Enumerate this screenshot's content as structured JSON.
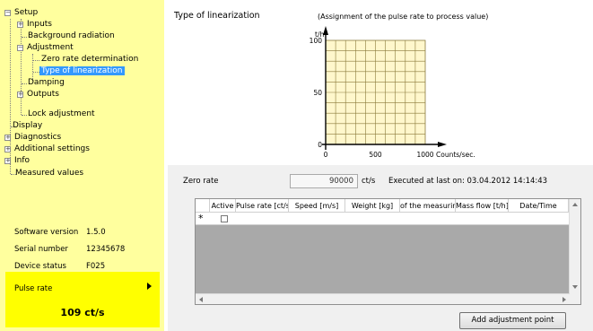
{
  "tree": {
    "items": [
      {
        "label": "Setup",
        "expander": "−"
      },
      {
        "label": "Inputs",
        "expander": "+"
      },
      {
        "label": "Background radiation"
      },
      {
        "label": "Adjustment",
        "expander": "−"
      },
      {
        "label": "Zero rate determination"
      },
      {
        "label": "Type of linearization",
        "selected": true
      },
      {
        "label": "Damping"
      },
      {
        "label": "Outputs",
        "expander": "+"
      },
      {
        "label": "Lock adjustment"
      },
      {
        "label": "Display"
      },
      {
        "label": "Diagnostics",
        "expander": "+"
      },
      {
        "label": "Additional settings",
        "expander": "+"
      },
      {
        "label": "Info",
        "expander": "+"
      },
      {
        "label": "Measured values"
      }
    ]
  },
  "device_info": {
    "software_version_label": "Software version",
    "software_version": "1.5.0",
    "serial_number_label": "Serial number",
    "serial_number": "12345678",
    "device_status_label": "Device status",
    "device_status": "F025"
  },
  "pulse": {
    "label": "Pulse rate",
    "value": "109 ct/s"
  },
  "section": {
    "title": "Type of linearization",
    "subtitle": "(Assignment of the pulse rate to process value)"
  },
  "chart_data": {
    "type": "line",
    "ylabel": "t/h",
    "xlabel": "Counts/sec.",
    "xlim": [
      0,
      1000
    ],
    "ylim": [
      0,
      100
    ],
    "x_ticks": [
      "0",
      "500",
      "1000"
    ],
    "y_ticks": [
      "0",
      "50",
      "100"
    ],
    "grid": true,
    "series": []
  },
  "zero_rate": {
    "label": "Zero rate",
    "value": "90000",
    "unit": "ct/s",
    "executed_text": "Executed at last on: 03.04.2012 14:14:43"
  },
  "table": {
    "columns": [
      "Active",
      "Pulse rate [ct/s]",
      "Speed [m/s]",
      "Weight [kg]",
      "of the measuring",
      "Mass flow [t/h]",
      "Date/Time"
    ],
    "new_row_marker": "*"
  },
  "buttons": {
    "add_point": "Add adjustment point"
  }
}
